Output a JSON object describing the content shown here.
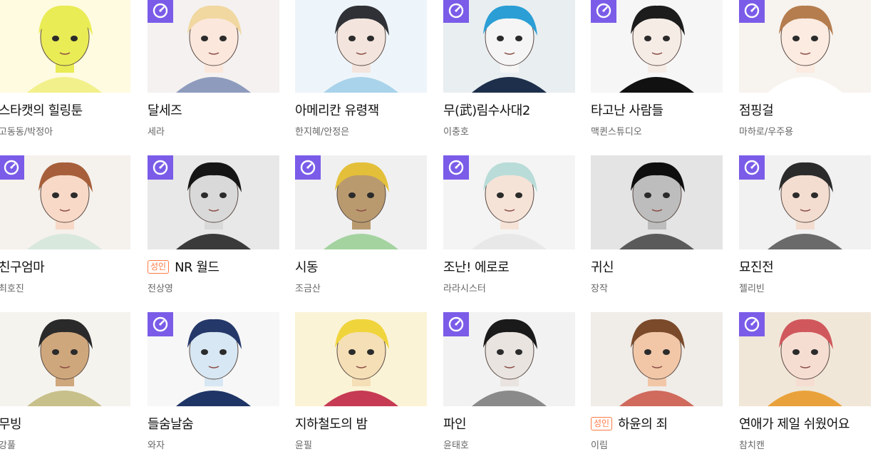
{
  "colors": {
    "badge": "#7a5ce8",
    "adult_tag": "#ff7a45",
    "title": "#111111",
    "author": "#666666"
  },
  "badge_icon": "clock-icon",
  "rows": [
    [
      {
        "title": "스타캣의 힐링툰",
        "author": "고동동/박정아",
        "badge": false,
        "adult": false,
        "art": {
          "bg": "#fffbe0",
          "skin": "#e9ec55",
          "hair": "#e9ec55",
          "cloth": "#f2f08a"
        }
      },
      {
        "title": "달세즈",
        "author": "세라",
        "badge": true,
        "adult": false,
        "art": {
          "bg": "#f4f1f0",
          "skin": "#fbe7dc",
          "hair": "#f1d7a0",
          "cloth": "#8e9bbd"
        }
      },
      {
        "title": "아메리칸 유령잭",
        "author": "한지혜/안정은",
        "badge": false,
        "adult": false,
        "art": {
          "bg": "#eef5fa",
          "skin": "#f3e5dd",
          "hair": "#2f3136",
          "cloth": "#a9d3ea"
        }
      },
      {
        "title": "무(武)림수사대2",
        "author": "이충호",
        "badge": true,
        "adult": false,
        "art": {
          "bg": "#e9eef1",
          "skin": "#f5f5f5",
          "hair": "#2a9ed5",
          "cloth": "#1d2f4a"
        }
      },
      {
        "title": "타고난 사람들",
        "author": "맥퀸스튜디오",
        "badge": true,
        "adult": false,
        "art": {
          "bg": "#f6f6f6",
          "skin": "#f6ece6",
          "hair": "#1c1c1c",
          "cloth": "#111111"
        }
      },
      {
        "title": "점핑걸",
        "author": "마하로/우주용",
        "badge": true,
        "adult": false,
        "art": {
          "bg": "#f7f3ee",
          "skin": "#fbebe1",
          "hair": "#b57d4e",
          "cloth": "#ffffff"
        }
      }
    ],
    [
      {
        "title": "친구엄마",
        "author": "최호진",
        "badge": true,
        "adult": false,
        "art": {
          "bg": "#f5f1ec",
          "skin": "#f8d9c7",
          "hair": "#a65f3a",
          "cloth": "#d9e8dd"
        }
      },
      {
        "title": "NR 월드",
        "author": "전상영",
        "badge": true,
        "adult": true,
        "art": {
          "bg": "#e8e8e8",
          "skin": "#d9d9d9",
          "hair": "#151515",
          "cloth": "#3a3a3a"
        }
      },
      {
        "title": "시동",
        "author": "조금산",
        "badge": true,
        "adult": false,
        "art": {
          "bg": "#f0f0f0",
          "skin": "#b99a6f",
          "hair": "#e4c03a",
          "cloth": "#a4d3a0"
        }
      },
      {
        "title": "조난! 에로로",
        "author": "라라시스터",
        "badge": true,
        "adult": false,
        "art": {
          "bg": "#f4f4f4",
          "skin": "#f6e3d8",
          "hair": "#b9dcd8",
          "cloth": "#e8e8e8"
        }
      },
      {
        "title": "귀신",
        "author": "장작",
        "badge": false,
        "adult": false,
        "art": {
          "bg": "#e4e4e4",
          "skin": "#bdbdbd",
          "hair": "#0e0e0e",
          "cloth": "#5a5a5a"
        }
      },
      {
        "title": "묘진전",
        "author": "젤리빈",
        "badge": true,
        "adult": false,
        "art": {
          "bg": "#f1f1f1",
          "skin": "#f3ddd0",
          "hair": "#2b2b2b",
          "cloth": "#6a6a6a"
        }
      }
    ],
    [
      {
        "title": "무빙",
        "author": "강풀",
        "badge": false,
        "adult": false,
        "art": {
          "bg": "#f5f3ee",
          "skin": "#cfa77c",
          "hair": "#2a2a2a",
          "cloth": "#c8c08a"
        }
      },
      {
        "title": "들숨날숨",
        "author": "와자",
        "badge": true,
        "adult": false,
        "art": {
          "bg": "#f7f7f7",
          "skin": "#d7e7f3",
          "hair": "#24386a",
          "cloth": "#1f3566"
        }
      },
      {
        "title": "지하철도의 밤",
        "author": "윤필",
        "badge": false,
        "adult": false,
        "art": {
          "bg": "#fbf3d6",
          "skin": "#f5dfb6",
          "hair": "#f0d43b",
          "cloth": "#c63a53"
        }
      },
      {
        "title": "파인",
        "author": "윤태호",
        "badge": true,
        "adult": false,
        "art": {
          "bg": "#f2f2f2",
          "skin": "#e9e4e0",
          "hair": "#1a1a1a",
          "cloth": "#8a8a8a"
        }
      },
      {
        "title": "하윤의 죄",
        "author": "이림",
        "badge": false,
        "adult": true,
        "art": {
          "bg": "#f0ece8",
          "skin": "#f1c7a8",
          "hair": "#7a4a2a",
          "cloth": "#d06a5c"
        }
      },
      {
        "title": "연애가 제일 쉬웠어요",
        "author": "참치캔",
        "badge": true,
        "adult": false,
        "art": {
          "bg": "#f1e7d8",
          "skin": "#f6ddd2",
          "hair": "#d0585c",
          "cloth": "#e9a23b"
        }
      }
    ]
  ],
  "adult_label": "성인"
}
